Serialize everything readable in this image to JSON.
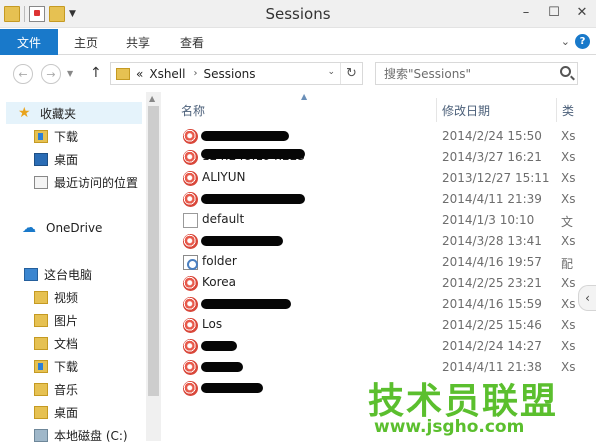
{
  "window": {
    "title": "Sessions",
    "minimize": "–",
    "maximize": "☐",
    "close": "✕"
  },
  "ribbon": {
    "tabs": [
      "文件",
      "主页",
      "共享",
      "查看"
    ],
    "expand_glyph": "⌄",
    "help": "?"
  },
  "address": {
    "breadcrumb": [
      "Xshell",
      "Sessions"
    ],
    "prefix": "«",
    "separator": "›"
  },
  "search": {
    "placeholder": "搜索\"Sessions\""
  },
  "nav": {
    "favorites": "收藏夹",
    "downloads": "下载",
    "desktop": "桌面",
    "recent": "最近访问的位置",
    "onedrive": "OneDrive",
    "thispc": "这台电脑",
    "videos": "视频",
    "pictures": "图片",
    "documents": "文档",
    "downloads2": "下载",
    "music": "音乐",
    "desktop2": "桌面",
    "localdisk": "本地磁盘 (C:)"
  },
  "columns": {
    "name": "名称",
    "date": "修改日期",
    "type": "类"
  },
  "files": [
    {
      "name": "",
      "date": "2014/2/24 15:50",
      "type": "Xs",
      "icon": "xshell-icon"
    },
    {
      "name": "124.248.194.223",
      "date": "2014/3/27 16:21",
      "type": "Xs",
      "icon": "xshell-icon"
    },
    {
      "name": "ALIYUN",
      "date": "2013/12/27 15:11",
      "type": "Xs",
      "icon": "xshell-icon"
    },
    {
      "name": "",
      "date": "2014/4/11 21:39",
      "type": "Xs",
      "icon": "xshell-icon"
    },
    {
      "name": "default",
      "date": "2014/1/3 10:10",
      "type": "文",
      "icon": "document-icon"
    },
    {
      "name": "",
      "date": "2014/3/28 13:41",
      "type": "Xs",
      "icon": "xshell-icon"
    },
    {
      "name": "folder",
      "date": "2014/4/16 19:57",
      "type": "配",
      "icon": "config-icon"
    },
    {
      "name": "Korea",
      "date": "2014/2/25 23:21",
      "type": "Xs",
      "icon": "xshell-icon"
    },
    {
      "name": "",
      "date": "2014/4/16 15:59",
      "type": "Xs",
      "icon": "xshell-icon"
    },
    {
      "name": "Los",
      "date": "2014/2/25 15:46",
      "type": "Xs",
      "icon": "xshell-icon"
    },
    {
      "name": "",
      "date": "2014/2/24 14:27",
      "type": "Xs",
      "icon": "xshell-icon"
    },
    {
      "name": "",
      "date": "2014/4/11 21:38",
      "type": "Xs",
      "icon": "xshell-icon"
    },
    {
      "name": "",
      "date": "",
      "type": "",
      "icon": "xshell-icon"
    }
  ],
  "watermark": {
    "title": "技术员联盟",
    "url": "www.jsgho.com"
  }
}
